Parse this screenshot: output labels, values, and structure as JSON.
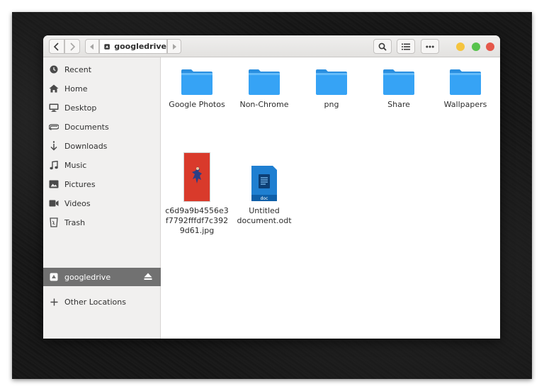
{
  "header": {
    "location": "googledrive"
  },
  "sidebar": {
    "items": [
      {
        "label": "Recent",
        "icon": "clock-icon"
      },
      {
        "label": "Home",
        "icon": "home-icon"
      },
      {
        "label": "Desktop",
        "icon": "monitor-icon"
      },
      {
        "label": "Documents",
        "icon": "paperclip-icon"
      },
      {
        "label": "Downloads",
        "icon": "download-icon"
      },
      {
        "label": "Music",
        "icon": "music-note-icon"
      },
      {
        "label": "Pictures",
        "icon": "picture-icon"
      },
      {
        "label": "Videos",
        "icon": "video-camera-icon"
      },
      {
        "label": "Trash",
        "icon": "trash-icon"
      },
      {
        "label": "googledrive",
        "icon": "drive-icon",
        "active": true
      },
      {
        "label": "Other Locations",
        "icon": "plus-icon"
      }
    ]
  },
  "files": [
    {
      "name": "Google Photos",
      "type": "folder"
    },
    {
      "name": "Non-Chrome",
      "type": "folder"
    },
    {
      "name": "png",
      "type": "folder"
    },
    {
      "name": "Share",
      "type": "folder"
    },
    {
      "name": "Wallpapers",
      "type": "folder"
    },
    {
      "name": "c6d9a9b4556e3f7792fffdf7c3929d61.jpg",
      "type": "image"
    },
    {
      "name": "Untitled document.odt",
      "type": "document",
      "badge": "doc"
    }
  ],
  "colors": {
    "folder": "#2e9bf0",
    "active_sidebar": "#717171",
    "close": "#e5584a",
    "minimize": "#f5c43e",
    "maximize": "#58c34d"
  }
}
